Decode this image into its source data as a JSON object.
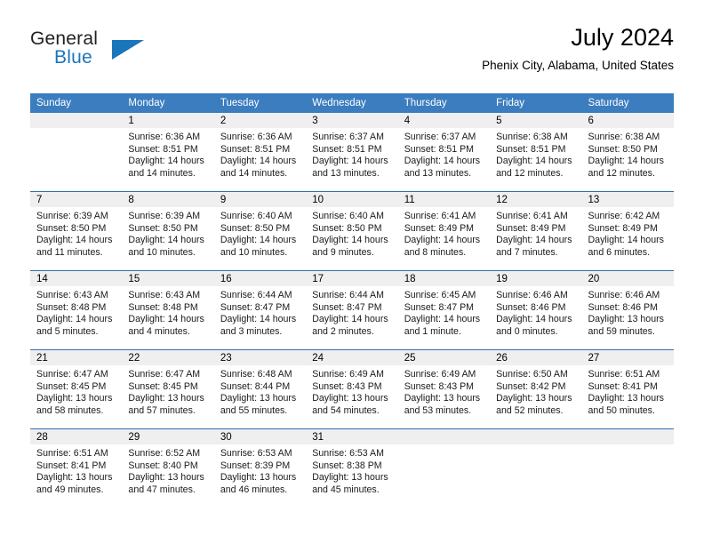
{
  "logo": {
    "primary_text": "General",
    "secondary_text": "Blue",
    "primary_color": "#231f20",
    "accent_color": "#1b75bb"
  },
  "header": {
    "title": "July 2024",
    "subtitle": "Phenix City, Alabama, United States"
  },
  "theme": {
    "header_bg": "#3b7dbf",
    "header_text": "#ffffff",
    "daynum_band": "#efefef",
    "row_rule": "#2f6fae"
  },
  "calendar": {
    "weekday_headers": [
      "Sunday",
      "Monday",
      "Tuesday",
      "Wednesday",
      "Thursday",
      "Friday",
      "Saturday"
    ],
    "weeks": [
      [
        {
          "day": "",
          "sunrise": "",
          "sunset": "",
          "daylight_line1": "",
          "daylight_line2": "",
          "empty": true
        },
        {
          "day": "1",
          "sunrise": "Sunrise: 6:36 AM",
          "sunset": "Sunset: 8:51 PM",
          "daylight_line1": "Daylight: 14 hours",
          "daylight_line2": "and 14 minutes."
        },
        {
          "day": "2",
          "sunrise": "Sunrise: 6:36 AM",
          "sunset": "Sunset: 8:51 PM",
          "daylight_line1": "Daylight: 14 hours",
          "daylight_line2": "and 14 minutes."
        },
        {
          "day": "3",
          "sunrise": "Sunrise: 6:37 AM",
          "sunset": "Sunset: 8:51 PM",
          "daylight_line1": "Daylight: 14 hours",
          "daylight_line2": "and 13 minutes."
        },
        {
          "day": "4",
          "sunrise": "Sunrise: 6:37 AM",
          "sunset": "Sunset: 8:51 PM",
          "daylight_line1": "Daylight: 14 hours",
          "daylight_line2": "and 13 minutes."
        },
        {
          "day": "5",
          "sunrise": "Sunrise: 6:38 AM",
          "sunset": "Sunset: 8:51 PM",
          "daylight_line1": "Daylight: 14 hours",
          "daylight_line2": "and 12 minutes."
        },
        {
          "day": "6",
          "sunrise": "Sunrise: 6:38 AM",
          "sunset": "Sunset: 8:50 PM",
          "daylight_line1": "Daylight: 14 hours",
          "daylight_line2": "and 12 minutes."
        }
      ],
      [
        {
          "day": "7",
          "sunrise": "Sunrise: 6:39 AM",
          "sunset": "Sunset: 8:50 PM",
          "daylight_line1": "Daylight: 14 hours",
          "daylight_line2": "and 11 minutes."
        },
        {
          "day": "8",
          "sunrise": "Sunrise: 6:39 AM",
          "sunset": "Sunset: 8:50 PM",
          "daylight_line1": "Daylight: 14 hours",
          "daylight_line2": "and 10 minutes."
        },
        {
          "day": "9",
          "sunrise": "Sunrise: 6:40 AM",
          "sunset": "Sunset: 8:50 PM",
          "daylight_line1": "Daylight: 14 hours",
          "daylight_line2": "and 10 minutes."
        },
        {
          "day": "10",
          "sunrise": "Sunrise: 6:40 AM",
          "sunset": "Sunset: 8:50 PM",
          "daylight_line1": "Daylight: 14 hours",
          "daylight_line2": "and 9 minutes."
        },
        {
          "day": "11",
          "sunrise": "Sunrise: 6:41 AM",
          "sunset": "Sunset: 8:49 PM",
          "daylight_line1": "Daylight: 14 hours",
          "daylight_line2": "and 8 minutes."
        },
        {
          "day": "12",
          "sunrise": "Sunrise: 6:41 AM",
          "sunset": "Sunset: 8:49 PM",
          "daylight_line1": "Daylight: 14 hours",
          "daylight_line2": "and 7 minutes."
        },
        {
          "day": "13",
          "sunrise": "Sunrise: 6:42 AM",
          "sunset": "Sunset: 8:49 PM",
          "daylight_line1": "Daylight: 14 hours",
          "daylight_line2": "and 6 minutes."
        }
      ],
      [
        {
          "day": "14",
          "sunrise": "Sunrise: 6:43 AM",
          "sunset": "Sunset: 8:48 PM",
          "daylight_line1": "Daylight: 14 hours",
          "daylight_line2": "and 5 minutes."
        },
        {
          "day": "15",
          "sunrise": "Sunrise: 6:43 AM",
          "sunset": "Sunset: 8:48 PM",
          "daylight_line1": "Daylight: 14 hours",
          "daylight_line2": "and 4 minutes."
        },
        {
          "day": "16",
          "sunrise": "Sunrise: 6:44 AM",
          "sunset": "Sunset: 8:47 PM",
          "daylight_line1": "Daylight: 14 hours",
          "daylight_line2": "and 3 minutes."
        },
        {
          "day": "17",
          "sunrise": "Sunrise: 6:44 AM",
          "sunset": "Sunset: 8:47 PM",
          "daylight_line1": "Daylight: 14 hours",
          "daylight_line2": "and 2 minutes."
        },
        {
          "day": "18",
          "sunrise": "Sunrise: 6:45 AM",
          "sunset": "Sunset: 8:47 PM",
          "daylight_line1": "Daylight: 14 hours",
          "daylight_line2": "and 1 minute."
        },
        {
          "day": "19",
          "sunrise": "Sunrise: 6:46 AM",
          "sunset": "Sunset: 8:46 PM",
          "daylight_line1": "Daylight: 14 hours",
          "daylight_line2": "and 0 minutes."
        },
        {
          "day": "20",
          "sunrise": "Sunrise: 6:46 AM",
          "sunset": "Sunset: 8:46 PM",
          "daylight_line1": "Daylight: 13 hours",
          "daylight_line2": "and 59 minutes."
        }
      ],
      [
        {
          "day": "21",
          "sunrise": "Sunrise: 6:47 AM",
          "sunset": "Sunset: 8:45 PM",
          "daylight_line1": "Daylight: 13 hours",
          "daylight_line2": "and 58 minutes."
        },
        {
          "day": "22",
          "sunrise": "Sunrise: 6:47 AM",
          "sunset": "Sunset: 8:45 PM",
          "daylight_line1": "Daylight: 13 hours",
          "daylight_line2": "and 57 minutes."
        },
        {
          "day": "23",
          "sunrise": "Sunrise: 6:48 AM",
          "sunset": "Sunset: 8:44 PM",
          "daylight_line1": "Daylight: 13 hours",
          "daylight_line2": "and 55 minutes."
        },
        {
          "day": "24",
          "sunrise": "Sunrise: 6:49 AM",
          "sunset": "Sunset: 8:43 PM",
          "daylight_line1": "Daylight: 13 hours",
          "daylight_line2": "and 54 minutes."
        },
        {
          "day": "25",
          "sunrise": "Sunrise: 6:49 AM",
          "sunset": "Sunset: 8:43 PM",
          "daylight_line1": "Daylight: 13 hours",
          "daylight_line2": "and 53 minutes."
        },
        {
          "day": "26",
          "sunrise": "Sunrise: 6:50 AM",
          "sunset": "Sunset: 8:42 PM",
          "daylight_line1": "Daylight: 13 hours",
          "daylight_line2": "and 52 minutes."
        },
        {
          "day": "27",
          "sunrise": "Sunrise: 6:51 AM",
          "sunset": "Sunset: 8:41 PM",
          "daylight_line1": "Daylight: 13 hours",
          "daylight_line2": "and 50 minutes."
        }
      ],
      [
        {
          "day": "28",
          "sunrise": "Sunrise: 6:51 AM",
          "sunset": "Sunset: 8:41 PM",
          "daylight_line1": "Daylight: 13 hours",
          "daylight_line2": "and 49 minutes."
        },
        {
          "day": "29",
          "sunrise": "Sunrise: 6:52 AM",
          "sunset": "Sunset: 8:40 PM",
          "daylight_line1": "Daylight: 13 hours",
          "daylight_line2": "and 47 minutes."
        },
        {
          "day": "30",
          "sunrise": "Sunrise: 6:53 AM",
          "sunset": "Sunset: 8:39 PM",
          "daylight_line1": "Daylight: 13 hours",
          "daylight_line2": "and 46 minutes."
        },
        {
          "day": "31",
          "sunrise": "Sunrise: 6:53 AM",
          "sunset": "Sunset: 8:38 PM",
          "daylight_line1": "Daylight: 13 hours",
          "daylight_line2": "and 45 minutes."
        },
        {
          "day": "",
          "sunrise": "",
          "sunset": "",
          "daylight_line1": "",
          "daylight_line2": "",
          "empty": true
        },
        {
          "day": "",
          "sunrise": "",
          "sunset": "",
          "daylight_line1": "",
          "daylight_line2": "",
          "empty": true
        },
        {
          "day": "",
          "sunrise": "",
          "sunset": "",
          "daylight_line1": "",
          "daylight_line2": "",
          "empty": true
        }
      ]
    ]
  }
}
